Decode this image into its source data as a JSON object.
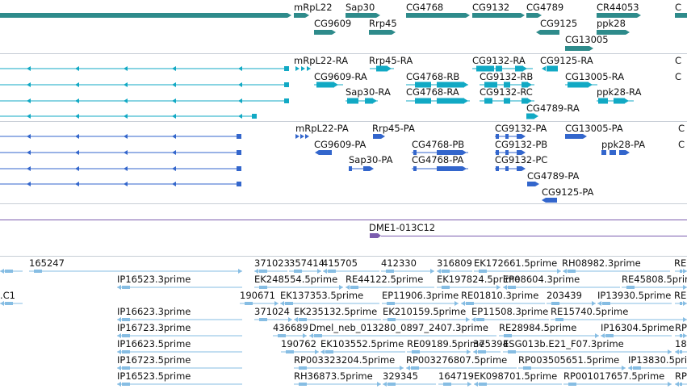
{
  "colors": {
    "gene": "#2e8b8b",
    "transcript": "#11a9c4",
    "cds": "#3366cc",
    "clone": "#7b5cae",
    "est": "#86bde3",
    "separator": "#c7ced6",
    "text": "#111111"
  },
  "genes": [
    {
      "label": "mRpL22",
      "strand": "+"
    },
    {
      "label": "Sap30",
      "strand": "+"
    },
    {
      "label": "CG4768",
      "strand": "+"
    },
    {
      "label": "CG9132",
      "strand": "+"
    },
    {
      "label": "CG4789",
      "strand": "+"
    },
    {
      "label": "CR44053",
      "strand": "+"
    },
    {
      "label": "CG9609",
      "strand": "+"
    },
    {
      "label": "Rrp45",
      "strand": "+"
    },
    {
      "label": "CG9125",
      "strand": "-"
    },
    {
      "label": "ppk28",
      "strand": "+"
    },
    {
      "label": "CG13005",
      "strand": "+"
    }
  ],
  "transcripts": [
    {
      "label": "mRpL22-RA"
    },
    {
      "label": "Rrp45-RA"
    },
    {
      "label": "CG9132-RA"
    },
    {
      "label": "CG9125-RA"
    },
    {
      "label": "CG9609-RA"
    },
    {
      "label": "CG4768-RB"
    },
    {
      "label": "CG9132-RB"
    },
    {
      "label": "CG13005-RA"
    },
    {
      "label": "Sap30-RA"
    },
    {
      "label": "CG4768-RA"
    },
    {
      "label": "CG9132-RC"
    },
    {
      "label": "ppk28-RA"
    },
    {
      "label": "CG4789-RA"
    }
  ],
  "cds": [
    {
      "label": "mRpL22-PA"
    },
    {
      "label": "Rrp45-PA"
    },
    {
      "label": "CG9132-PA"
    },
    {
      "label": "CG13005-PA"
    },
    {
      "label": "CG9609-PA"
    },
    {
      "label": "CG4768-PB"
    },
    {
      "label": "CG9132-PB"
    },
    {
      "label": "ppk28-PA"
    },
    {
      "label": "Sap30-PA"
    },
    {
      "label": "CG4768-PA"
    },
    {
      "label": "CG9132-PC"
    },
    {
      "label": "CG4789-PA"
    },
    {
      "label": "CG9125-PA"
    }
  ],
  "clones": [
    {
      "label": "DME1-013C12"
    }
  ],
  "est_labels": [
    "165247",
    "371023",
    "357414",
    "415705",
    "412330",
    "316809",
    "EK172661.5prime",
    "RH08982.3prime",
    "IP16523.3prime",
    "EK248554.5prime",
    "RE44122.5prime",
    "EK197824.5prime",
    "EP08604.3prime",
    "RE45808.5prime",
    ".C1",
    "190671",
    "EK137353.5prime",
    "EP11906.3prime",
    "RE01810.3prime",
    "203439",
    "IP13930.5prime",
    "IP16623.3prime",
    "371024",
    "EK235132.5prime",
    "EK210159.5prime",
    "EP11508.3prime",
    "RE15740.5prime",
    "IP16723.3prime",
    "436689",
    "Dmel_neb_013280_0897_2407.3prime",
    "RE28984.5prime",
    "IP16304.5prime",
    "IP16623.5prime",
    "190762",
    "EK103552.5prime",
    "RE09189.5prime",
    "375394",
    "ESG013b.E21_F07.3prime",
    "IP16723.5prime",
    "RP003323204.5prime",
    "RP003276807.5prime",
    "RP003505651.5prime",
    "IP13830.5prime",
    "IP16523.5prime",
    "RH36873.5prime",
    "329345",
    "164719",
    "EK098701.5prime",
    "RP001017657.5prime"
  ]
}
